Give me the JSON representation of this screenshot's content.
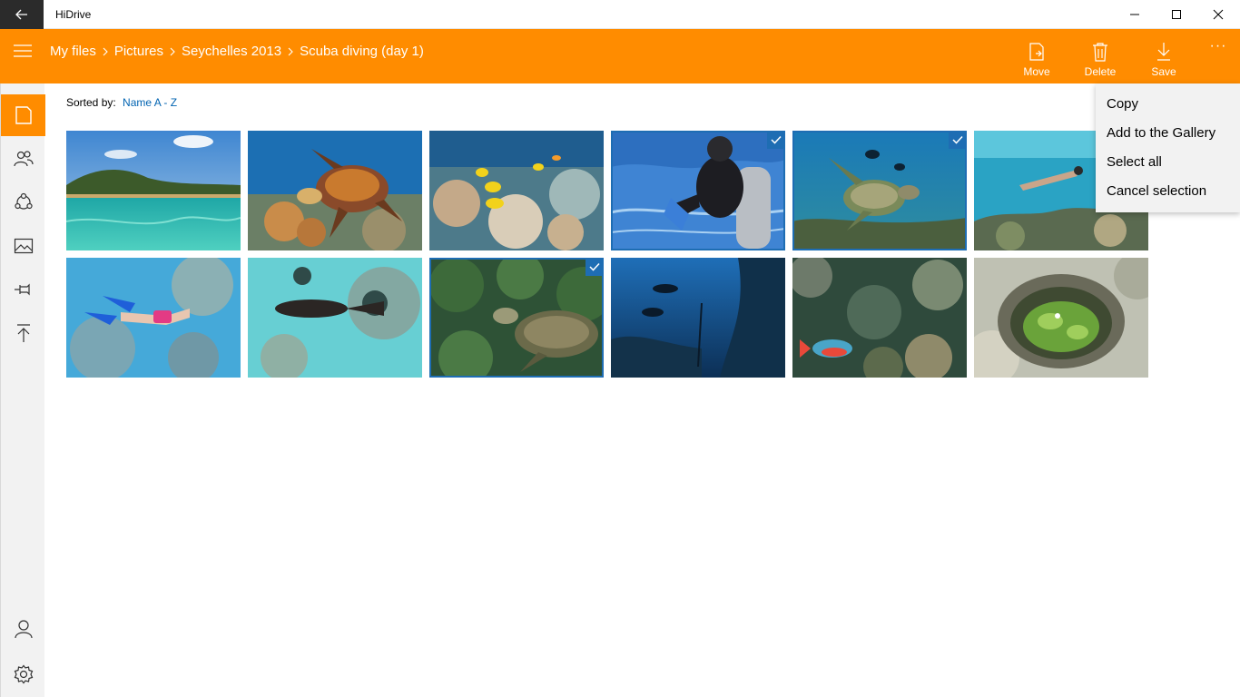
{
  "app": {
    "title": "HiDrive"
  },
  "breadcrumb": [
    "My files",
    "Pictures",
    "Seychelles 2013",
    "Scuba diving (day 1)"
  ],
  "commands": {
    "move": "Move",
    "delete": "Delete",
    "save": "Save",
    "more": "···"
  },
  "sort": {
    "label": "Sorted by:",
    "value": "Name A - Z"
  },
  "menu": [
    "Copy",
    "Add to the Gallery",
    "Select all",
    "Cancel selection"
  ],
  "photos": [
    {
      "name": "beach-lagoon",
      "selected": false
    },
    {
      "name": "hawksbill-turtle",
      "selected": false
    },
    {
      "name": "coral-reef-fish",
      "selected": false
    },
    {
      "name": "diver-with-tank",
      "selected": true
    },
    {
      "name": "turtle-with-divers",
      "selected": true
    },
    {
      "name": "snorkeler-reef",
      "selected": false
    },
    {
      "name": "snorkeler-pink",
      "selected": false
    },
    {
      "name": "fish-sandy-bottom",
      "selected": false
    },
    {
      "name": "turtle-on-coral",
      "selected": true
    },
    {
      "name": "divers-deep-blue",
      "selected": false
    },
    {
      "name": "parrotfish-reef",
      "selected": false
    },
    {
      "name": "anemone-rock",
      "selected": false
    }
  ],
  "colors": {
    "accent": "#ff8c00",
    "selection": "#1e6db3",
    "link": "#0063b1"
  }
}
